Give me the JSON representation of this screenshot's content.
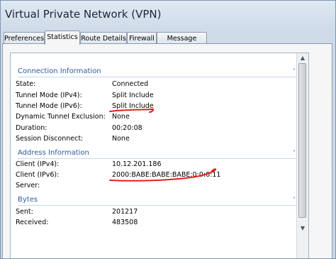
{
  "window": {
    "title": "Virtual Private Network (VPN)"
  },
  "tabs": [
    {
      "label": "Preferences"
    },
    {
      "label": "Statistics"
    },
    {
      "label": "Route Details"
    },
    {
      "label": "Firewall"
    },
    {
      "label": "Message History"
    }
  ],
  "active_tab": "Statistics",
  "sections": {
    "connection": {
      "header": "Connection Information",
      "rows": [
        {
          "label": "State:",
          "value": "Connected"
        },
        {
          "label": "Tunnel Mode (IPv4):",
          "value": "Split Include"
        },
        {
          "label": "Tunnel Mode (IPv6):",
          "value": "Split Include"
        },
        {
          "label": "Dynamic Tunnel Exclusion:",
          "value": "None"
        },
        {
          "label": "Duration:",
          "value": "00:20:08"
        },
        {
          "label": "Session Disconnect:",
          "value": "None"
        }
      ]
    },
    "address": {
      "header": "Address Information",
      "rows": [
        {
          "label": "Client (IPv4):",
          "value": "10.12.201.186"
        },
        {
          "label": "Client (IPv6):",
          "value": "2000:BABE:BABE:BABE:0:0:0:11"
        },
        {
          "label": "Server:",
          "value": ""
        }
      ]
    },
    "bytes": {
      "header": "Bytes",
      "rows": [
        {
          "label": "Sent:",
          "value": "201217"
        },
        {
          "label": "Received:",
          "value": "483508"
        }
      ]
    }
  },
  "icons": {
    "collapse": "chevron-up-icon",
    "scroll_up": "arrow-up-icon",
    "scroll_down": "arrow-down-icon"
  },
  "colors": {
    "section_header": "#2b5d9e",
    "annotation": "#e0201b"
  }
}
